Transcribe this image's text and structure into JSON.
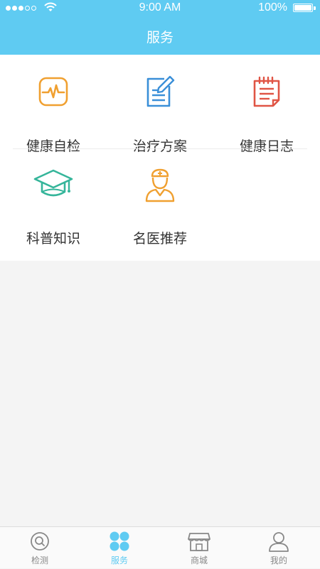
{
  "status_bar": {
    "time": "9:00 AM",
    "battery": "100%",
    "signal_icon": "signal-dots-icon",
    "wifi_icon": "wifi-icon",
    "battery_icon": "battery-icon"
  },
  "header": {
    "title": "服务",
    "background": "#5fcbf2"
  },
  "services": [
    {
      "label": "健康自检",
      "icon": "heartbeat-monitor-icon",
      "color": "#f0a030"
    },
    {
      "label": "治疗方案",
      "icon": "document-pen-icon",
      "color": "#3a8fd8"
    },
    {
      "label": "健康日志",
      "icon": "notepad-icon",
      "color": "#e05545"
    },
    {
      "label": "科普知识",
      "icon": "graduation-cap-icon",
      "color": "#35b59a"
    },
    {
      "label": "名医推荐",
      "icon": "doctor-icon",
      "color": "#f0a030"
    }
  ],
  "tab_bar": {
    "active_color": "#5fcbf2",
    "inactive_color": "#888888",
    "tabs": [
      {
        "label": "检测",
        "icon": "detect-icon",
        "active": false
      },
      {
        "label": "服务",
        "icon": "grid-icon",
        "active": true
      },
      {
        "label": "商城",
        "icon": "shop-icon",
        "active": false
      },
      {
        "label": "我的",
        "icon": "user-icon",
        "active": false
      }
    ]
  }
}
